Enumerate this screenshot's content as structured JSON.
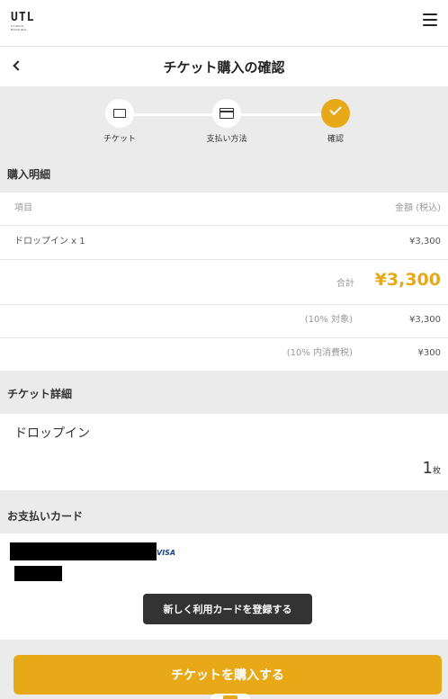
{
  "brand": {
    "logo_text": "UTL",
    "logo_sub": "STUDIO · BOOKING"
  },
  "header": {
    "title": "チケット購入の確認"
  },
  "steps": [
    {
      "label": "チケット",
      "icon": "ticket-icon",
      "state": "done"
    },
    {
      "label": "支払い方法",
      "icon": "credit-card-icon",
      "state": "done"
    },
    {
      "label": "確認",
      "icon": "check-icon",
      "state": "current"
    }
  ],
  "purchase": {
    "section_title": "購入明細",
    "col_item": "項目",
    "col_amount": "金額 (税込)",
    "item_name": "ドロップイン x 1",
    "item_amount": "¥3,300",
    "total_label": "合計",
    "total_value": "¥3,300",
    "tax_base_label": "(10% 対象)",
    "tax_base_value": "¥3,300",
    "tax_label": "(10% 内消費税)",
    "tax_value": "¥300"
  },
  "ticket": {
    "section_title": "チケット詳細",
    "name": "ドロップイン",
    "quantity": "1",
    "unit": "枚"
  },
  "card": {
    "section_title": "お支払いカード",
    "brand": "VISA",
    "register_label": "新しく利用カードを登録する"
  },
  "actions": {
    "purchase_label": "チケットを購入する"
  },
  "colors": {
    "accent": "#e8a918",
    "dark_button": "#333333",
    "section_bg": "#ebebeb"
  }
}
